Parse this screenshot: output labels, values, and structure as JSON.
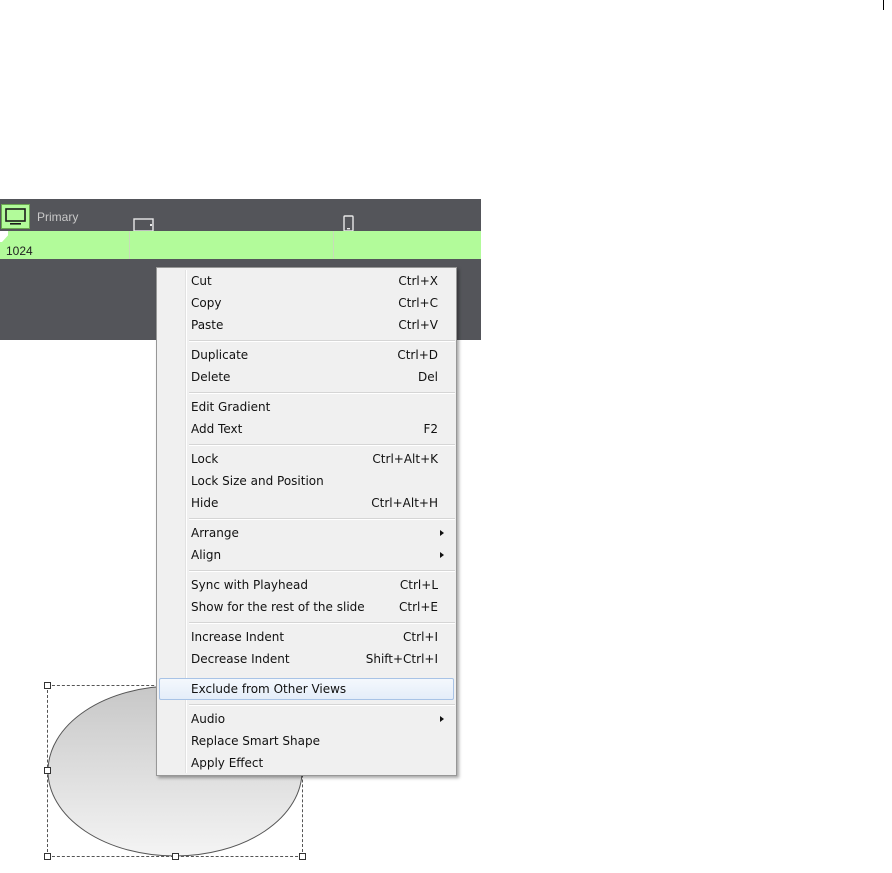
{
  "viewbar": {
    "primary_label": "Primary",
    "width_value": "1024",
    "icons": [
      "desktop-icon",
      "tablet-icon",
      "phone-icon"
    ]
  },
  "colors": {
    "active_view": "#b2fb9a",
    "bar": "#54555a",
    "menu_bg": "#f0f0f0",
    "highlight": "#e4edf9"
  },
  "menu": {
    "cut": {
      "label": "Cut",
      "shortcut": "Ctrl+X"
    },
    "copy": {
      "label": "Copy",
      "shortcut": "Ctrl+C"
    },
    "paste": {
      "label": "Paste",
      "shortcut": "Ctrl+V"
    },
    "duplicate": {
      "label": "Duplicate",
      "shortcut": "Ctrl+D"
    },
    "delete": {
      "label": "Delete",
      "shortcut": "Del"
    },
    "edit_gradient": {
      "label": "Edit Gradient",
      "shortcut": ""
    },
    "add_text": {
      "label": "Add Text",
      "shortcut": "F2"
    },
    "lock": {
      "label": "Lock",
      "shortcut": "Ctrl+Alt+K"
    },
    "lock_size": {
      "label": "Lock Size and Position",
      "shortcut": ""
    },
    "hide": {
      "label": "Hide",
      "shortcut": "Ctrl+Alt+H"
    },
    "arrange": {
      "label": "Arrange"
    },
    "align": {
      "label": "Align"
    },
    "sync": {
      "label": "Sync with Playhead",
      "shortcut": "Ctrl+L"
    },
    "show_rest": {
      "label": "Show for the rest of the slide",
      "shortcut": "Ctrl+E"
    },
    "increase_indent": {
      "label": "Increase Indent",
      "shortcut": "Ctrl+I"
    },
    "decrease_indent": {
      "label": "Decrease Indent",
      "shortcut": "Shift+Ctrl+I"
    },
    "exclude": {
      "label": "Exclude from Other Views"
    },
    "audio": {
      "label": "Audio"
    },
    "replace_shape": {
      "label": "Replace Smart Shape"
    },
    "apply_effect": {
      "label": "Apply Effect"
    }
  }
}
